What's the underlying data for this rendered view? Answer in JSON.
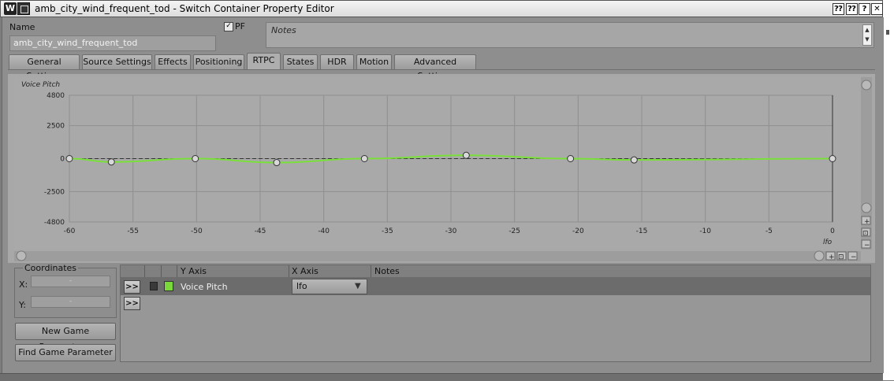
{
  "window": {
    "title": "amb_city_wind_frequent_tod - Switch Container Property Editor",
    "buttons": [
      "⁇",
      "⁇",
      "?",
      "✕"
    ]
  },
  "name_section": {
    "label": "Name",
    "value": "amb_city_wind_frequent_tod",
    "pf_label": "PF",
    "pf_checked": true,
    "notes_placeholder": "Notes"
  },
  "tabs": [
    {
      "label": "General Settings",
      "active": false
    },
    {
      "label": "Source Settings",
      "active": false
    },
    {
      "label": "Effects",
      "active": false
    },
    {
      "label": "Positioning",
      "active": false
    },
    {
      "label": "RTPC",
      "active": true
    },
    {
      "label": "States",
      "active": false
    },
    {
      "label": "HDR",
      "active": false
    },
    {
      "label": "Motion",
      "active": false
    },
    {
      "label": "Advanced Settings",
      "active": false
    }
  ],
  "chart_data": {
    "type": "line",
    "ylabel": "Voice Pitch",
    "xlabel": "lfo",
    "xlim": [
      -60,
      0
    ],
    "ylim": [
      -4800,
      4800
    ],
    "x_ticks": [
      -60,
      -55,
      -50,
      -45,
      -40,
      -35,
      -30,
      -25,
      -20,
      -15,
      -10,
      -5,
      0
    ],
    "y_ticks": [
      4800,
      2500,
      0,
      -2500,
      -4800
    ],
    "grid": true,
    "series": [
      {
        "name": "Voice Pitch",
        "color": "#7ae03a",
        "points": [
          {
            "x": -60,
            "y": 0
          },
          {
            "x": -56.7,
            "y": -250
          },
          {
            "x": -50.1,
            "y": 0
          },
          {
            "x": -43.7,
            "y": -300
          },
          {
            "x": -36.8,
            "y": 0
          },
          {
            "x": -28.8,
            "y": 250
          },
          {
            "x": -20.6,
            "y": 0
          },
          {
            "x": -15.6,
            "y": -100
          },
          {
            "x": 0,
            "y": 0
          }
        ]
      }
    ]
  },
  "coordinates": {
    "title": "Coordinates",
    "x_label": "X:",
    "y_label": "Y:",
    "x_value": "-",
    "y_value": "-"
  },
  "buttons": {
    "new_game_parameter": "New Game Parameter...",
    "find_game_parameter": "Find Game Parameter"
  },
  "rtpc_table": {
    "headers": [
      "Y Axis",
      "X Axis",
      "Notes"
    ],
    "rows": [
      {
        "expand": ">>",
        "y_axis": "Voice Pitch",
        "x_axis": "lfo",
        "color": "#7ad83a"
      }
    ],
    "empty_row_expand": ">>"
  },
  "graph_controls": {
    "zoom_in": "+",
    "zoom_fit": "⊡",
    "zoom_out": "−"
  }
}
